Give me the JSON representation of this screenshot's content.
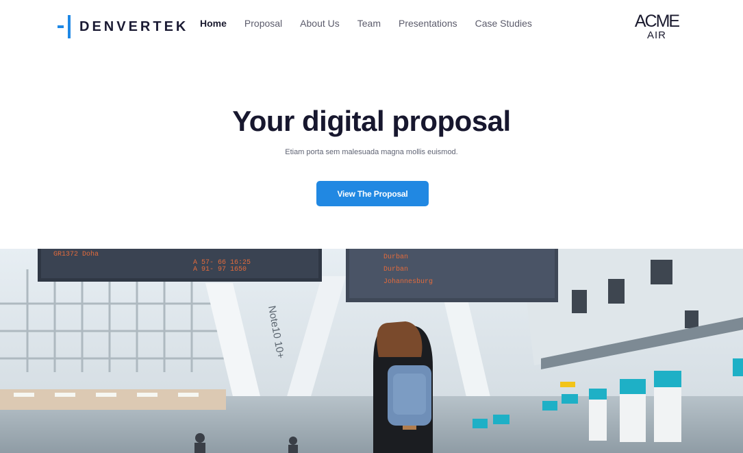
{
  "brand": {
    "name": "DENVERTEK",
    "accent_color": "#1e88e5"
  },
  "nav": {
    "items": [
      {
        "label": "Home",
        "active": true
      },
      {
        "label": "Proposal"
      },
      {
        "label": "About Us"
      },
      {
        "label": "Team"
      },
      {
        "label": "Presentations"
      },
      {
        "label": "Case Studies"
      }
    ]
  },
  "partner": {
    "line1": "ACME",
    "line2": "AIR"
  },
  "hero": {
    "title": "Your digital proposal",
    "subtitle": "Etiam porta sem malesuada magna mollis euismod.",
    "cta_label": "View The Proposal",
    "cta_color": "#2188e2"
  },
  "photo": {
    "board_left": [
      "GR1372  Doha",
      "A 57- 66  16:25",
      "A 91- 97  1650"
    ],
    "board_center": [
      "Durban",
      "Durban",
      "Johannesburg"
    ],
    "sign_text": "Note10  10+"
  }
}
